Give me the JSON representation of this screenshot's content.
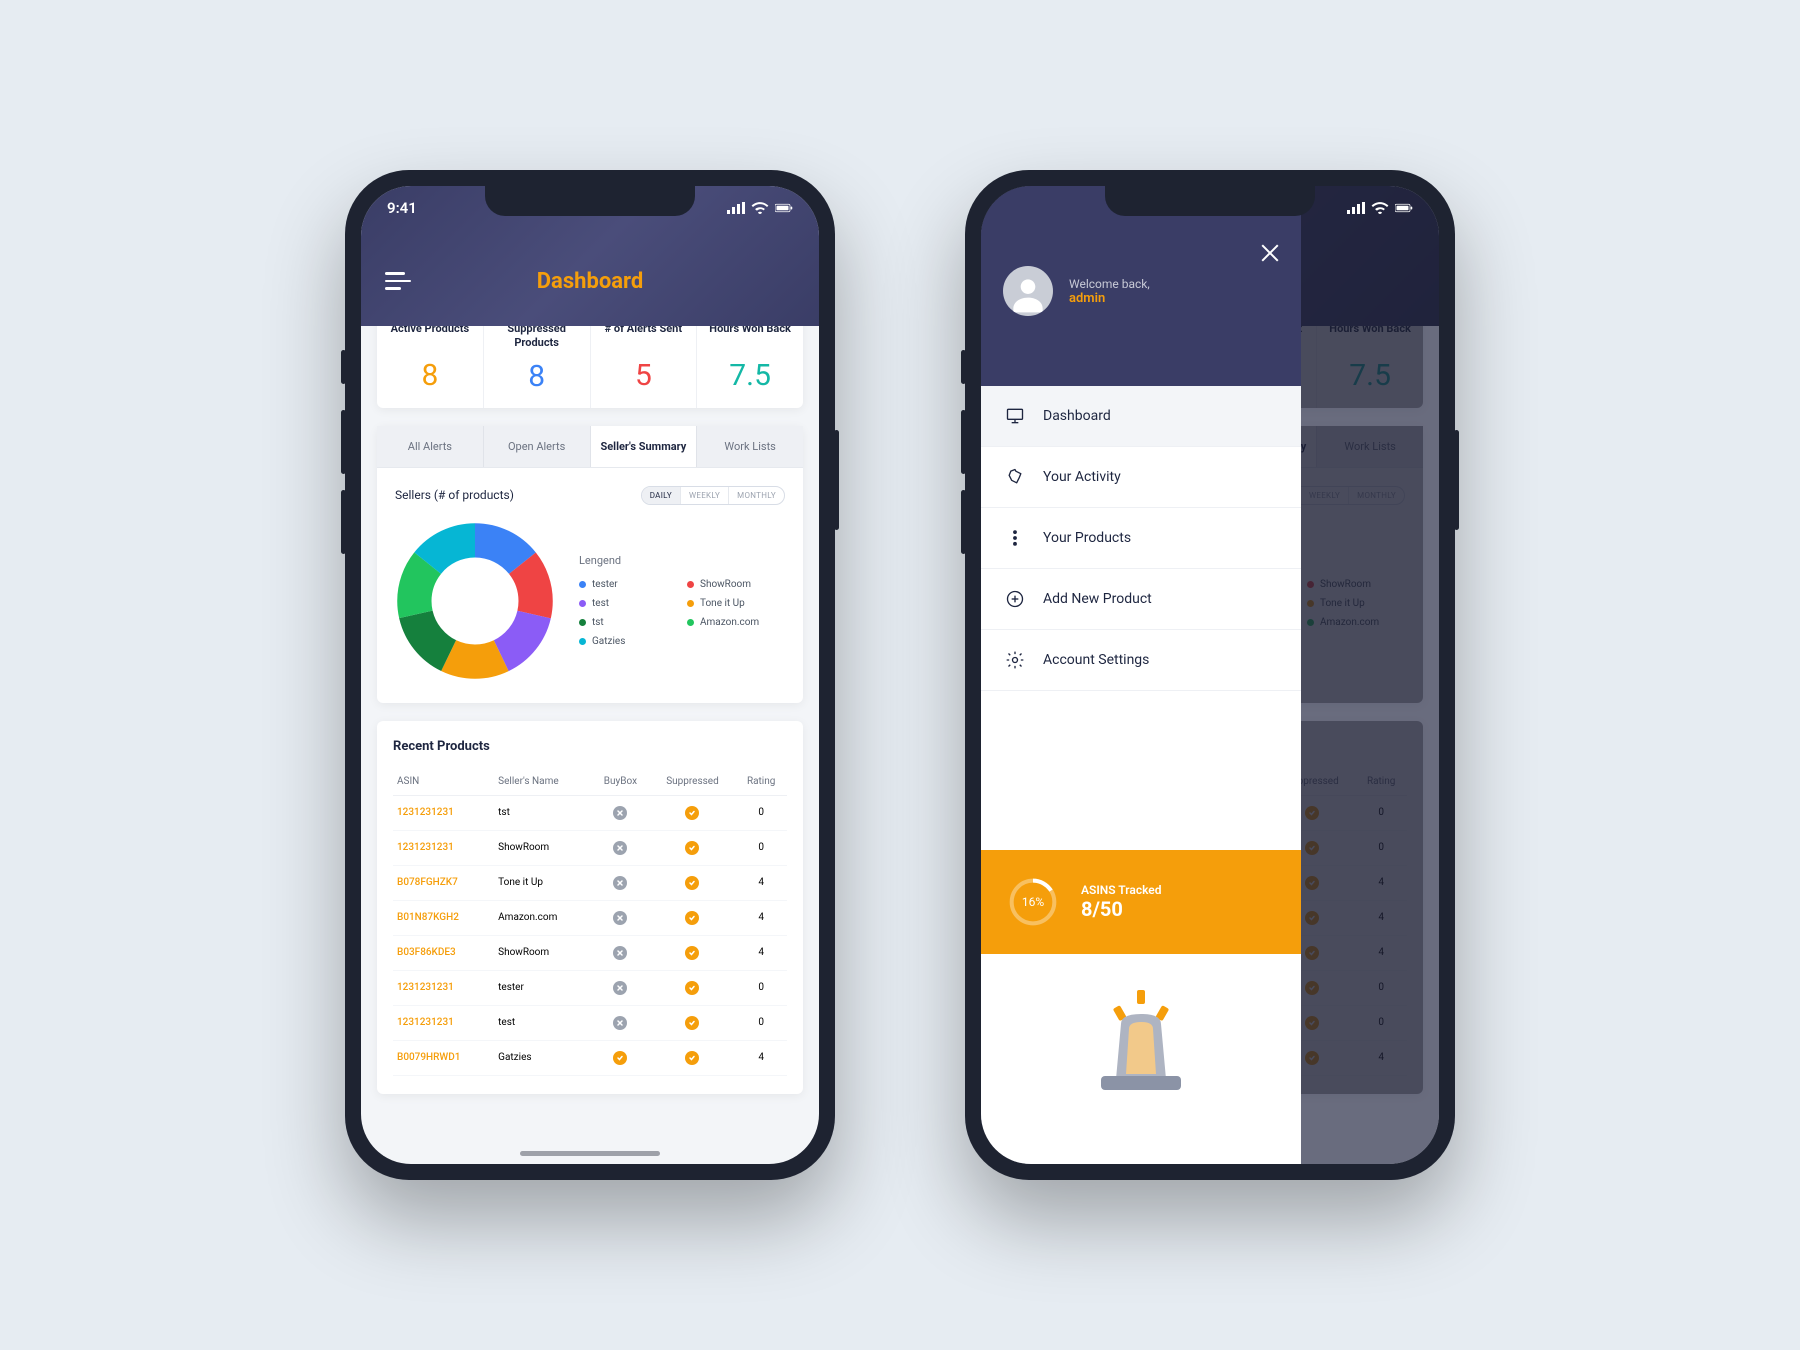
{
  "status": {
    "time": "9:41"
  },
  "header": {
    "title": "Dashboard"
  },
  "kpis": [
    {
      "label": "Active Products",
      "value": "8",
      "color": "orange"
    },
    {
      "label": "Suppressed Products",
      "value": "8",
      "color": "blue"
    },
    {
      "label": "# of Alerts Sent",
      "value": "5",
      "color": "red"
    },
    {
      "label": "Hours Won Back",
      "value": "7.5",
      "color": "teal"
    }
  ],
  "tabs": [
    "All Alerts",
    "Open Alerts",
    "Seller's Summary",
    "Work Lists"
  ],
  "active_tab": 2,
  "chart": {
    "title": "Sellers (# of products)",
    "ranges": [
      "DAILY",
      "WEEKLY",
      "MONTHLY"
    ],
    "active_range": 0,
    "legend_title": "Lengend",
    "legend": [
      {
        "label": "tester",
        "color": "#3b82f6"
      },
      {
        "label": "ShowRoom",
        "color": "#ef4444"
      },
      {
        "label": "test",
        "color": "#8b5cf6"
      },
      {
        "label": "Tone it Up",
        "color": "#f59e0b"
      },
      {
        "label": "tst",
        "color": "#15803d"
      },
      {
        "label": "Amazon.com",
        "color": "#22c55e"
      },
      {
        "label": "Gatzies",
        "color": "#06b6d4"
      }
    ]
  },
  "chart_data": {
    "type": "pie",
    "title": "Sellers (# of products)",
    "categories": [
      "tester",
      "ShowRoom",
      "test",
      "Tone it Up",
      "tst",
      "Amazon.com",
      "Gatzies"
    ],
    "values": [
      1,
      1,
      1,
      1,
      1,
      1,
      1
    ],
    "colors": [
      "#3b82f6",
      "#ef4444",
      "#8b5cf6",
      "#f59e0b",
      "#15803d",
      "#22c55e",
      "#06b6d4"
    ]
  },
  "table": {
    "title": "Recent Products",
    "columns": [
      "ASIN",
      "Seller's Name",
      "BuyBox",
      "Suppressed",
      "Rating"
    ],
    "rows": [
      {
        "asin": "1231231231",
        "seller": "tst",
        "buybox": "x",
        "suppressed": "check",
        "rating": "0"
      },
      {
        "asin": "1231231231",
        "seller": "ShowRoom",
        "buybox": "x",
        "suppressed": "check",
        "rating": "0"
      },
      {
        "asin": "B078FGHZK7",
        "seller": "Tone it Up",
        "buybox": "x",
        "suppressed": "check",
        "rating": "4"
      },
      {
        "asin": "B01N87KGH2",
        "seller": "Amazon.com",
        "buybox": "x",
        "suppressed": "check",
        "rating": "4"
      },
      {
        "asin": "B03F86KDE3",
        "seller": "ShowRoom",
        "buybox": "x",
        "suppressed": "check",
        "rating": "4"
      },
      {
        "asin": "1231231231",
        "seller": "tester",
        "buybox": "x",
        "suppressed": "check",
        "rating": "0"
      },
      {
        "asin": "1231231231",
        "seller": "test",
        "buybox": "x",
        "suppressed": "check",
        "rating": "0"
      },
      {
        "asin": "B0079HRWD1",
        "seller": "Gatzies",
        "buybox": "check",
        "suppressed": "check",
        "rating": "4"
      }
    ]
  },
  "drawer": {
    "welcome": "Welcome back,",
    "username": "admin",
    "items": [
      {
        "label": "Dashboard",
        "icon": "monitor",
        "active": true
      },
      {
        "label": "Your Activity",
        "icon": "bell",
        "active": false
      },
      {
        "label": "Your Products",
        "icon": "dots",
        "active": false
      },
      {
        "label": "Add New Product",
        "icon": "plus",
        "active": false
      },
      {
        "label": "Account Settings",
        "icon": "gear",
        "active": false
      }
    ],
    "asins": {
      "label": "ASINS Tracked",
      "value": "8/50",
      "percent": "16%",
      "percent_num": 16
    }
  }
}
